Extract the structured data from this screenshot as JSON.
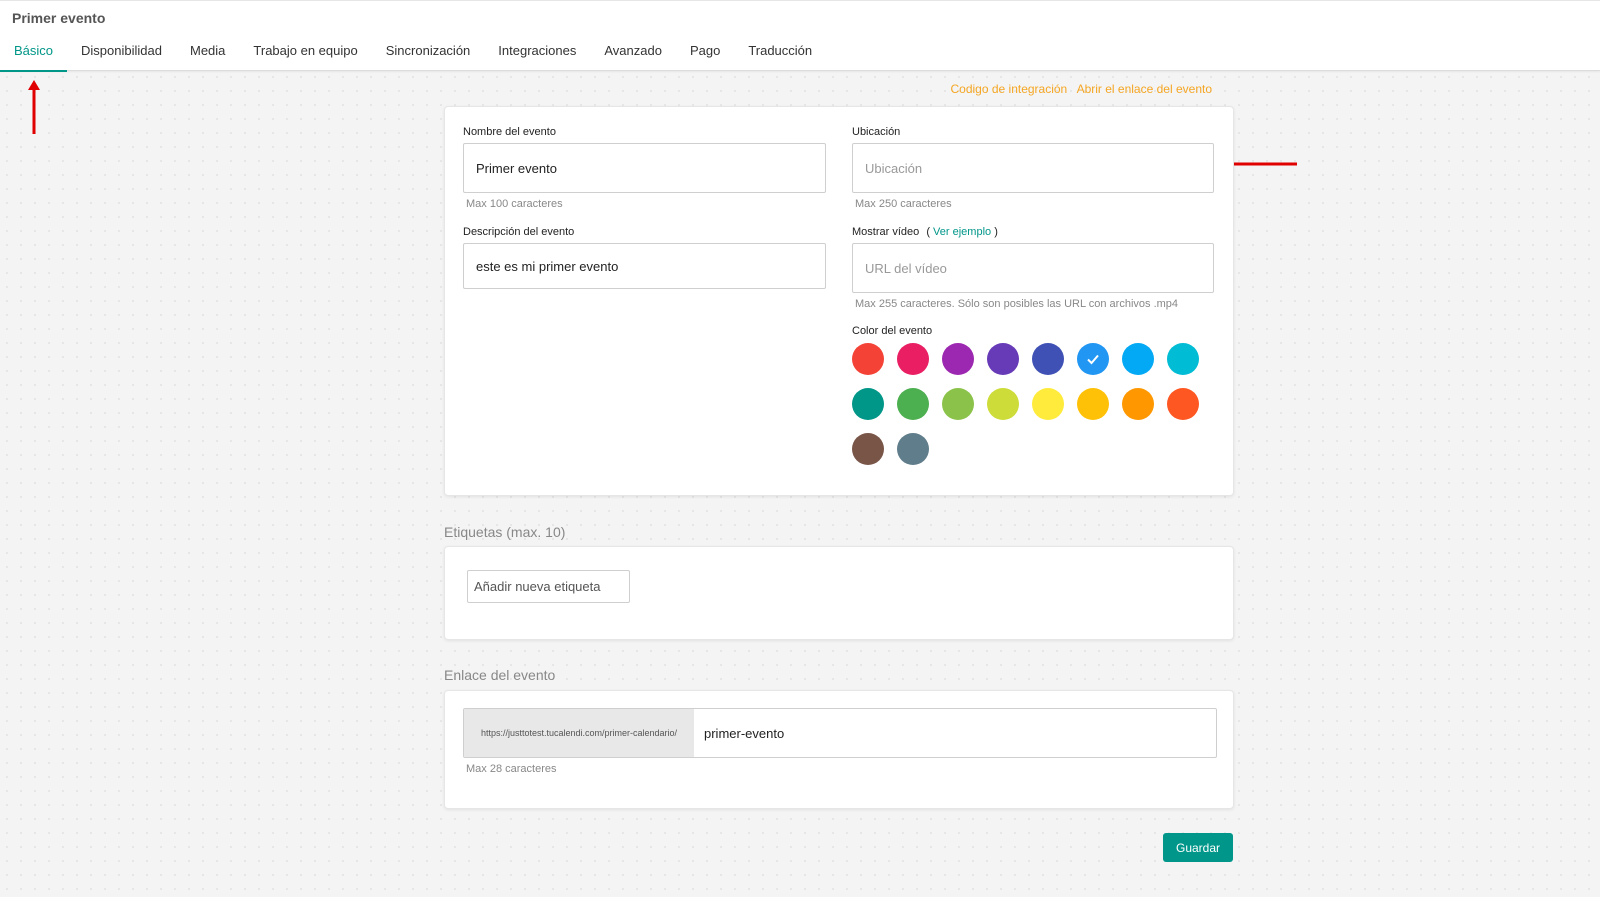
{
  "page": {
    "title": "Primer evento"
  },
  "tabs": [
    {
      "label": "Básico",
      "active": true
    },
    {
      "label": "Disponibilidad"
    },
    {
      "label": "Media"
    },
    {
      "label": "Trabajo en equipo"
    },
    {
      "label": "Sincronización"
    },
    {
      "label": "Integraciones"
    },
    {
      "label": "Avanzado"
    },
    {
      "label": "Pago"
    },
    {
      "label": "Traducción"
    }
  ],
  "links": {
    "embed_code": "Codigo de integración",
    "open_event": "Abrir el enlace del evento"
  },
  "basic": {
    "name_label": "Nombre del evento",
    "name_value": "Primer evento",
    "name_hint": "Max 100 caracteres",
    "location_label": "Ubicación",
    "location_placeholder": "Ubicación",
    "location_hint": "Max 250 caracteres",
    "description_label": "Descripción del evento",
    "description_value": "este es mi primer evento",
    "video_label": "Mostrar vídeo",
    "video_paren_open": "(",
    "video_example": "Ver ejemplo",
    "video_paren_close": ")",
    "video_placeholder": "URL del vídeo",
    "video_hint": "Max 255 caracteres. Sólo son posibles las URL con archivos .mp4",
    "color_label": "Color del evento",
    "colors": [
      "#f44336",
      "#e91e63",
      "#9c27b0",
      "#673ab7",
      "#3f51b5",
      "#2196f3",
      "#03a9f4",
      "#00bcd4",
      "#009688",
      "#4caf50",
      "#8bc34a",
      "#cddc39",
      "#ffeb3b",
      "#ffc107",
      "#ff9800",
      "#ff5722",
      "#795548",
      "#607d8b"
    ],
    "selected_color_index": 5
  },
  "tags": {
    "title": "Etiquetas (max. 10)",
    "input_placeholder": "Añadir nueva etiqueta"
  },
  "event_link": {
    "title": "Enlace del evento",
    "prefix": "https://justtotest.tucalendi.com/primer-calendario/",
    "slug": "primer-evento",
    "hint": "Max 28 caracteres"
  },
  "actions": {
    "save_label": "Guardar"
  },
  "accent": "#009688"
}
